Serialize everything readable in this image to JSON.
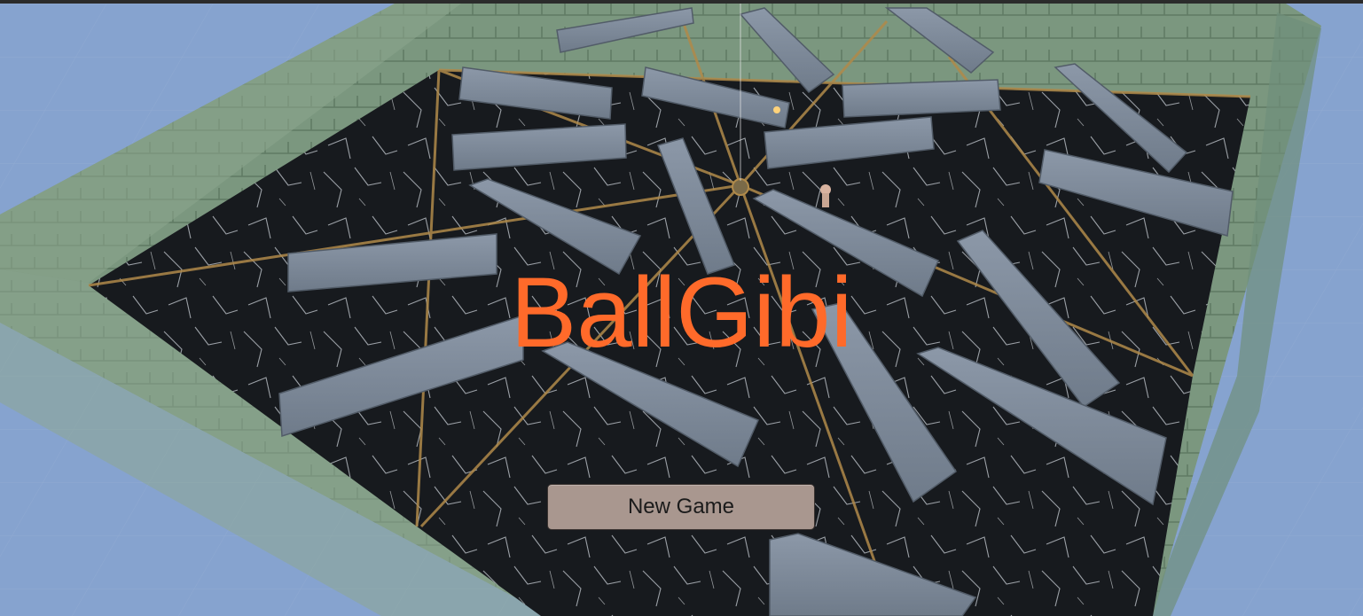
{
  "game": {
    "title": "BallGibi",
    "title_color": "#ff6a2a"
  },
  "menu": {
    "new_game_label": "New Game"
  },
  "colors": {
    "sky": "#7f9ccb",
    "wall": "#7f9a86",
    "floor": "#15181c",
    "block": "#7b8796",
    "button": "#a9978f"
  }
}
